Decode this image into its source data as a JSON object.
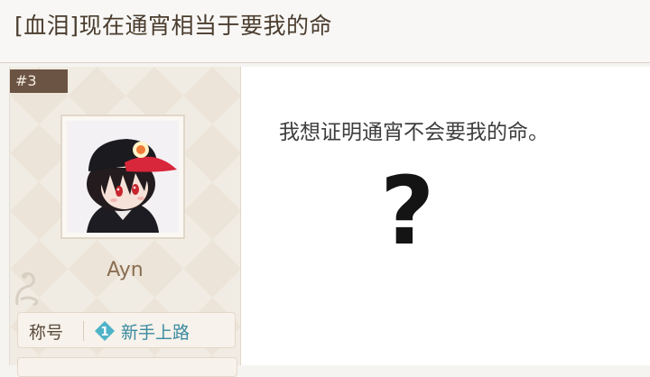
{
  "thread": {
    "title": "[血泪]现在通宵相当于要我的命"
  },
  "post": {
    "floor": "#3",
    "author": {
      "username": "Ayn",
      "avatar_icon": "anime-avatar"
    },
    "user_title": {
      "label": "称号",
      "rank_number": "1",
      "rank_name": "新手上路",
      "rank_color": "#4fb3c8"
    },
    "content": {
      "text": "我想证明通宵不会要我的命。",
      "emphasis": "?"
    }
  }
}
